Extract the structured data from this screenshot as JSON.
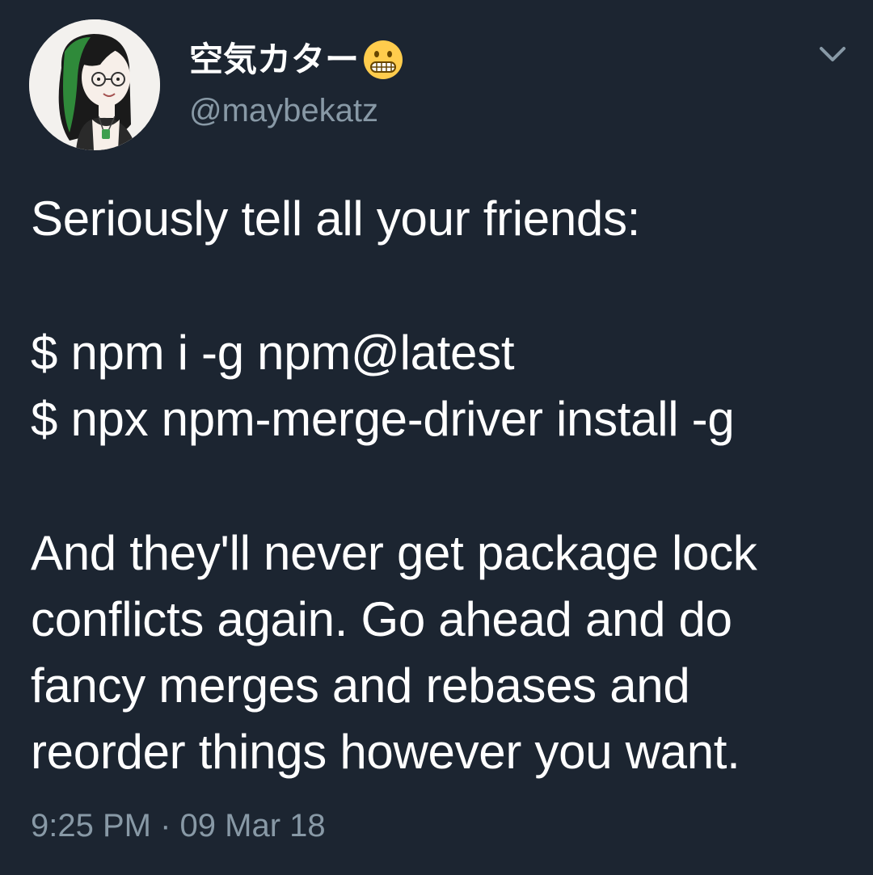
{
  "user": {
    "display_name": "空気カター",
    "emoji_icon": "grimacing-face-icon",
    "handle": "@maybekatz"
  },
  "menu": {
    "caret_icon": "chevron-down-icon"
  },
  "tweet": {
    "lines": [
      "Seriously tell all your friends:",
      "$ npm i -g npm@latest",
      "$ npx npm-merge-driver install -g",
      "And they'll never get package lock",
      "conflicts again. Go ahead and do",
      "fancy merges and rebases and",
      "reorder things however you want."
    ]
  },
  "meta": {
    "time": "9:25 PM",
    "separator": "·",
    "date": "09 Mar 18"
  },
  "colors": {
    "background": "#1c2531",
    "text": "#ffffff",
    "muted": "#8899a6"
  }
}
